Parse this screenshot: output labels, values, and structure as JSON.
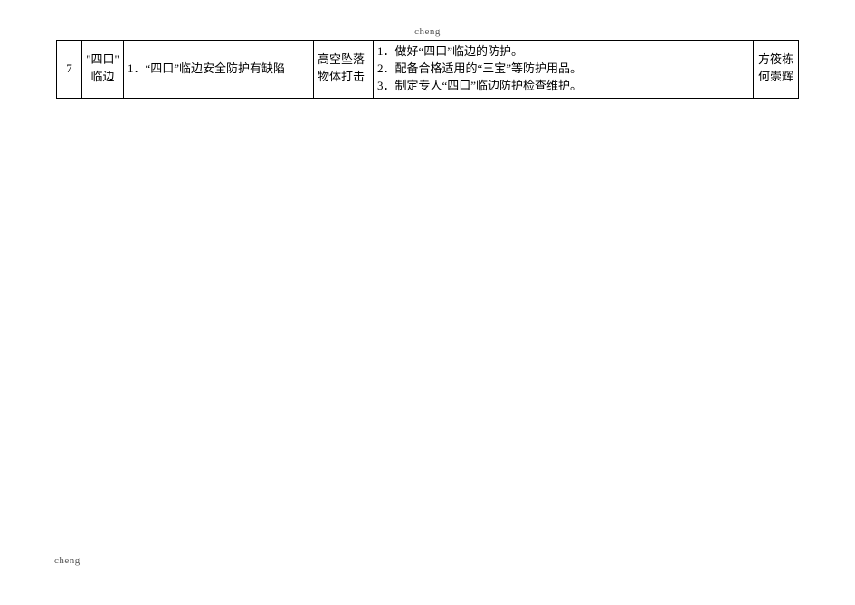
{
  "header": {
    "label": "cheng"
  },
  "footer": {
    "label": "cheng"
  },
  "table": {
    "rows": [
      {
        "num": "7",
        "category_line1": "\"四口\"",
        "category_line2": "临边",
        "issue": "1．“四口”临边安全防护有缺陷",
        "risk_line1": "高空坠落",
        "risk_line2": "物体打击",
        "measure1": "1．做好“四口”临边的防护。",
        "measure2": "2．配备合格适用的“三宝”等防护用品。",
        "measure3": "3．制定专人“四口”临边防护检查维护。",
        "person_line1": "方筱栋",
        "person_line2": "何崇辉"
      }
    ]
  }
}
